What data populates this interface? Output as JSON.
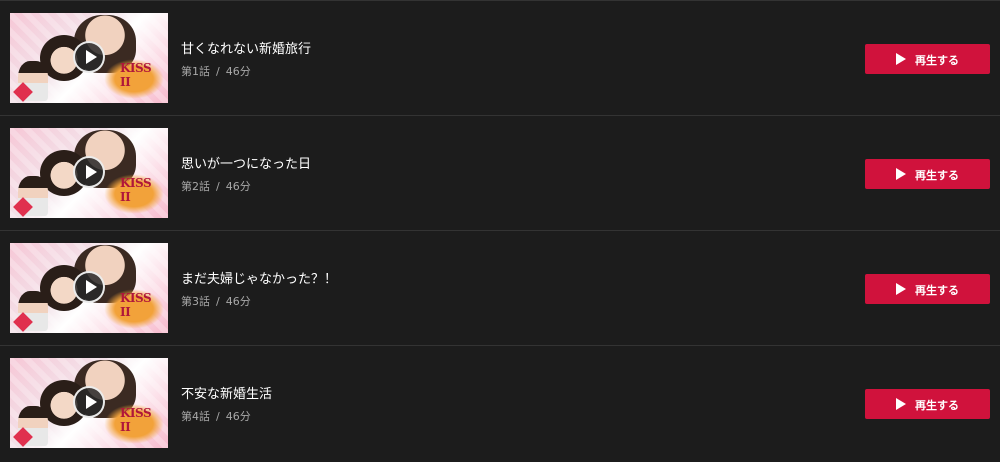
{
  "thumbnail_logo_text": "KISS II",
  "play_button_label": "再生する",
  "meta_separator": "/",
  "episodes": [
    {
      "title": "甘くなれない新婚旅行",
      "number": "第1話",
      "duration": "46分"
    },
    {
      "title": "思いが一つになった日",
      "number": "第2話",
      "duration": "46分"
    },
    {
      "title": "まだ夫婦じゃなかった？！",
      "number": "第3話",
      "duration": "46分"
    },
    {
      "title": "不安な新婚生活",
      "number": "第4話",
      "duration": "46分"
    }
  ],
  "colors": {
    "background": "#1c1c1c",
    "divider": "#333333",
    "accent": "#d0123c",
    "title_text": "#ffffff",
    "meta_text": "#a8a8a8"
  },
  "icons": {
    "thumbnail_play": "play-circle-icon",
    "button_play": "play-triangle-icon"
  }
}
